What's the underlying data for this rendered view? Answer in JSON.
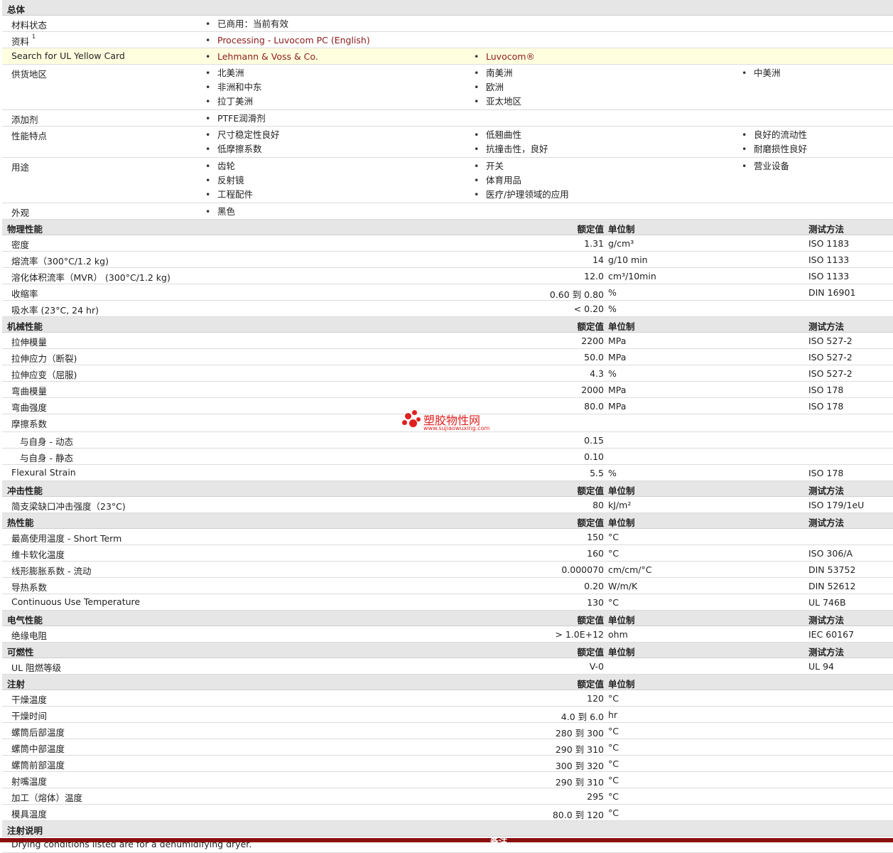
{
  "general": {
    "title": "总体",
    "rows": [
      {
        "label": "材料状态",
        "items": [
          [
            "已商用：当前有效"
          ]
        ]
      },
      {
        "label": "资料",
        "sup": "1",
        "items": [
          [
            "Processing - Luvocom PC (English)"
          ]
        ],
        "link": true
      },
      {
        "label": "Search for UL Yellow Card",
        "items": [
          [
            "Lehmann & Voss & Co."
          ],
          [
            "Luvocom®"
          ]
        ],
        "link": true,
        "highlight": true
      },
      {
        "label": "供货地区",
        "items": [
          [
            "北美洲",
            "非洲和中东",
            "拉丁美洲"
          ],
          [
            "南美洲",
            "欧洲",
            "亚太地区"
          ],
          [
            "中美洲"
          ]
        ]
      },
      {
        "label": "添加剂",
        "items": [
          [
            "PTFE润滑剂"
          ]
        ]
      },
      {
        "label": "性能特点",
        "items": [
          [
            "尺寸稳定性良好",
            "低摩擦系数"
          ],
          [
            "低翘曲性",
            "抗撞击性，良好"
          ],
          [
            "良好的流动性",
            "耐磨损性良好"
          ]
        ]
      },
      {
        "label": "用途",
        "items": [
          [
            "齿轮",
            "反射镜",
            "工程配件"
          ],
          [
            "开关",
            "体育用品",
            "医疗/护理领域的应用"
          ],
          [
            "营业设备"
          ]
        ]
      },
      {
        "label": "外观",
        "items": [
          [
            "黑色"
          ]
        ]
      }
    ]
  },
  "columns": {
    "value": "额定值",
    "unit": "单位制",
    "method": "测试方法"
  },
  "sections": [
    {
      "title": "物理性能",
      "method_header": true,
      "rows": [
        {
          "label": "密度",
          "value": "1.31",
          "unit": "g/cm³",
          "method": "ISO 1183"
        },
        {
          "label": "熔流率（300°C/1.2 kg)",
          "value": "14",
          "unit": "g/10 min",
          "method": "ISO 1133"
        },
        {
          "label": "溶化体积流率（MVR） (300°C/1.2 kg)",
          "value": "12.0",
          "unit": "cm³/10min",
          "method": "ISO 1133"
        },
        {
          "label": "收缩率",
          "value": "0.60 到  0.80",
          "unit": "%",
          "method": "DIN 16901"
        },
        {
          "label": "吸水率 (23°C, 24 hr)",
          "value": "< 0.20",
          "unit": "%",
          "method": ""
        }
      ]
    },
    {
      "title": "机械性能",
      "method_header": true,
      "rows": [
        {
          "label": "拉伸模量",
          "value": "2200",
          "unit": "MPa",
          "method": "ISO 527-2"
        },
        {
          "label": "拉伸应力（断裂)",
          "value": "50.0",
          "unit": "MPa",
          "method": "ISO 527-2"
        },
        {
          "label": "拉伸应变（屈服)",
          "value": "4.3",
          "unit": "%",
          "method": "ISO 527-2"
        },
        {
          "label": "弯曲模量",
          "value": "2000",
          "unit": "MPa",
          "method": "ISO 178"
        },
        {
          "label": "弯曲强度",
          "value": "80.0",
          "unit": "MPa",
          "method": "ISO 178"
        },
        {
          "label": "摩擦系数",
          "value": "",
          "unit": "",
          "method": "",
          "tall": true
        },
        {
          "label": "与自身  - 动态",
          "value": "0.15",
          "unit": "",
          "method": "",
          "sub": true
        },
        {
          "label": "与自身  - 静态",
          "value": "0.10",
          "unit": "",
          "method": "",
          "sub": true
        },
        {
          "label": "Flexural Strain",
          "value": "5.5",
          "unit": "%",
          "method": "ISO 178"
        }
      ]
    },
    {
      "title": "冲击性能",
      "method_header": true,
      "rows": [
        {
          "label": "简支梁缺口冲击强度（23°C)",
          "value": "80",
          "unit": "kJ/m²",
          "method": "ISO 179/1eU"
        }
      ]
    },
    {
      "title": "热性能",
      "method_header": true,
      "rows": [
        {
          "label": "最高使用温度  - Short Term",
          "value": "150",
          "unit": "°C",
          "method": ""
        },
        {
          "label": "维卡软化温度",
          "value": "160",
          "unit": "°C",
          "method": "ISO 306/A"
        },
        {
          "label": "线形膨胀系数  - 流动",
          "value": "0.000070",
          "unit": "cm/cm/°C",
          "method": "DIN 53752"
        },
        {
          "label": "导热系数",
          "value": "0.20",
          "unit": "W/m/K",
          "method": "DIN 52612"
        },
        {
          "label": "Continuous Use Temperature",
          "value": "130",
          "unit": "°C",
          "method": "UL 746B"
        }
      ]
    },
    {
      "title": "电气性能",
      "method_header": true,
      "rows": [
        {
          "label": "绝缘电阻",
          "value": "> 1.0E+12",
          "unit": "ohm",
          "method": "IEC 60167"
        }
      ]
    },
    {
      "title": "可燃性",
      "method_header": true,
      "rows": [
        {
          "label": "UL 阻燃等级",
          "value": "V-0",
          "unit": "",
          "method": "UL 94"
        }
      ]
    },
    {
      "title": "注射",
      "method_header": false,
      "rows": [
        {
          "label": "干燥温度",
          "value": "120",
          "unit": "°C",
          "method": ""
        },
        {
          "label": "干燥时间",
          "value": "4.0 到  6.0",
          "unit": "hr",
          "method": ""
        },
        {
          "label": "螺筒后部温度",
          "value": "280 到  300",
          "unit": "°C",
          "method": ""
        },
        {
          "label": "螺筒中部温度",
          "value": "290 到  310",
          "unit": "°C",
          "method": ""
        },
        {
          "label": "螺筒前部温度",
          "value": "300 到  320",
          "unit": "°C",
          "method": ""
        },
        {
          "label": "射嘴温度",
          "value": "290 到  310",
          "unit": "°C",
          "method": ""
        },
        {
          "label": "加工（熔体）温度",
          "value": "295",
          "unit": "°C",
          "method": ""
        },
        {
          "label": "模具温度",
          "value": "80.0 到  120",
          "unit": "°C",
          "method": ""
        }
      ]
    }
  ],
  "notes": {
    "title": "注射说明",
    "text": "Drying conditions listed are for a dehumidifying dryer."
  },
  "footer": {
    "label": "备注"
  },
  "watermark": {
    "name": "塑胶物性网",
    "url": "www.sujiaowuxing.com"
  }
}
